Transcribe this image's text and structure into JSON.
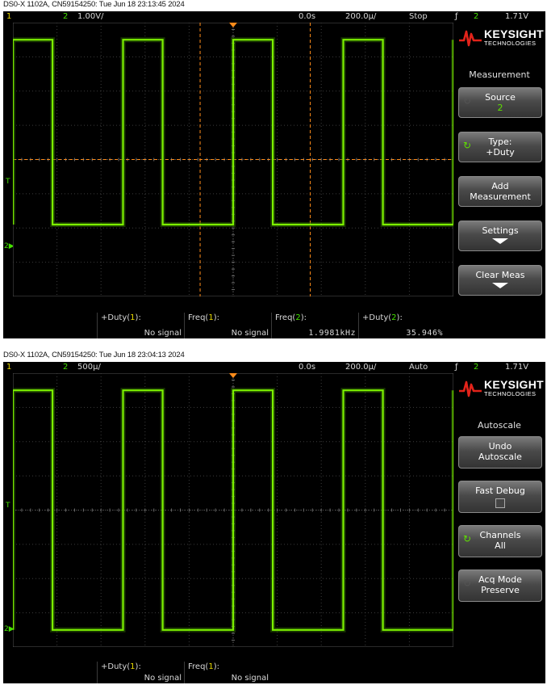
{
  "scopes": [
    {
      "caption": "DS0-X 1102A, CN59154250: Tue Jun 18 23:13:45 2024",
      "topbar": {
        "ch1_num": "1",
        "ch2_num": "2",
        "ch2_scale": "1.00V/",
        "time_offset": "0.0s",
        "time_scale": "200.0µ/",
        "run_state": "Stop",
        "trigger_slope": "ƒ",
        "trigger_source": "2",
        "trigger_level": "1.71V"
      },
      "waveform": {
        "high_level_div": 3.5,
        "low_level_div": -1.9,
        "period_div": 2.5,
        "duty": 0.36,
        "first_rise_div": 0.0
      },
      "cursors": {
        "vertical_div": [
          4.25,
          6.75
        ],
        "horizontal_div": 0.0
      },
      "ground_marker": "2",
      "trigger_marker": "T",
      "measurements": [
        {
          "label": "+Duty(1):",
          "value": "No signal"
        },
        {
          "label": "Freq(1):",
          "value": "No signal"
        },
        {
          "label": "Freq(2):",
          "value": "1.9981kHz"
        },
        {
          "label": "+Duty(2):",
          "value": "35.946%"
        }
      ],
      "menu": {
        "brand": "KEYSIGHT",
        "brand_sub": "TECHNOLOGIES",
        "title": "Measurement",
        "buttons": [
          {
            "line1": "Source",
            "line2": "2"
          },
          {
            "line1": "Type:",
            "line2": "+Duty"
          },
          {
            "line1": "Add",
            "line2": "Measurement"
          },
          {
            "line1": "Settings",
            "line2": ""
          },
          {
            "line1": "Clear Meas",
            "line2": ""
          }
        ]
      }
    },
    {
      "caption": "DS0-X 1102A, CN59154250: Tue Jun 18 23:04:13 2024",
      "topbar": {
        "ch1_num": "1",
        "ch2_num": "2",
        "ch2_scale": "500µ/",
        "time_offset": "0.0s",
        "time_scale": "200.0µ/",
        "run_state": "Auto",
        "trigger_slope": "ƒ",
        "trigger_source": "2",
        "trigger_level": "1.71V"
      },
      "waveform": {
        "high_level_div": 3.5,
        "low_level_div": -3.5,
        "period_div": 2.5,
        "duty": 0.36,
        "first_rise_div": 0.0
      },
      "ground_marker": "2",
      "trigger_marker": "T",
      "measurements": [
        {
          "label": "+Duty(1):",
          "value": "No signal"
        },
        {
          "label": "Freq(1):",
          "value": "No signal"
        }
      ],
      "menu": {
        "brand": "KEYSIGHT",
        "brand_sub": "TECHNOLOGIES",
        "title": "Autoscale",
        "buttons": [
          {
            "line1": "Undo",
            "line2": "Autoscale"
          },
          {
            "line1": "Fast Debug",
            "line2": ""
          },
          {
            "line1": "Channels",
            "line2": "All"
          },
          {
            "line1": "Acq Mode",
            "line2": "Preserve"
          }
        ]
      }
    }
  ]
}
